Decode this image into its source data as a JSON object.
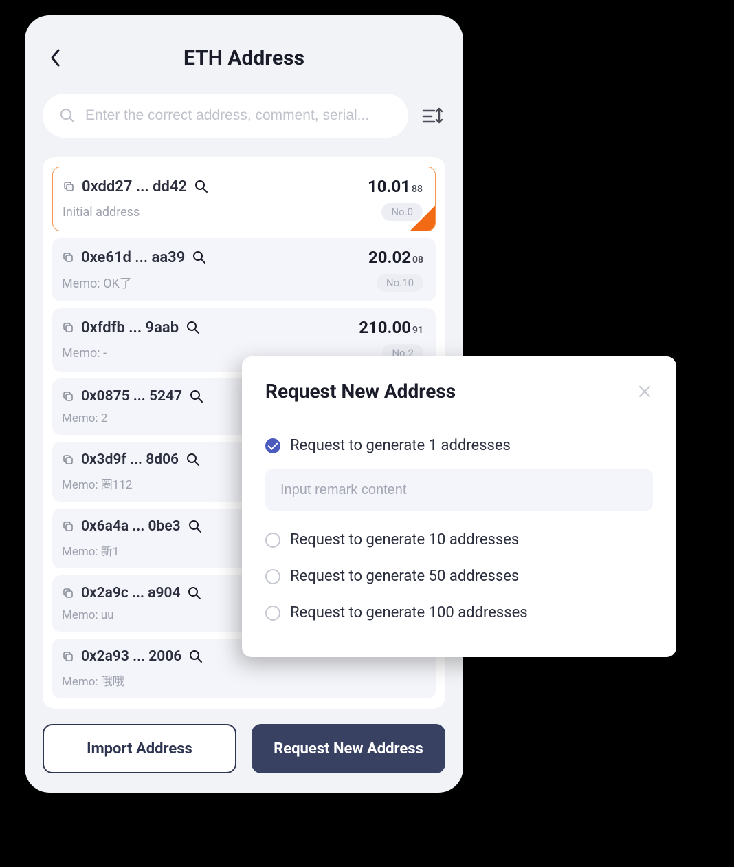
{
  "header": {
    "title": "ETH Address"
  },
  "search": {
    "placeholder": "Enter the correct address, comment, serial..."
  },
  "addresses": [
    {
      "addr": "0xdd27 ... dd42",
      "balance": "10.01",
      "balance_sub": "88",
      "memo": "Initial address",
      "no": "No.0",
      "selected": true
    },
    {
      "addr": "0xe61d ... aa39",
      "balance": "20.02",
      "balance_sub": "08",
      "memo": "Memo: OK了",
      "no": "No.10",
      "selected": false
    },
    {
      "addr": "0xfdfb ... 9aab",
      "balance": "210.00",
      "balance_sub": "91",
      "memo": "Memo: -",
      "no": "No.2",
      "selected": false
    },
    {
      "addr": "0x0875 ... 5247",
      "balance": "",
      "balance_sub": "",
      "memo": "Memo: 2",
      "no": "",
      "selected": false
    },
    {
      "addr": "0x3d9f ... 8d06",
      "balance": "",
      "balance_sub": "",
      "memo": "Memo: 圈112",
      "no": "",
      "selected": false
    },
    {
      "addr": "0x6a4a ... 0be3",
      "balance": "",
      "balance_sub": "",
      "memo": "Memo: 新1",
      "no": "",
      "selected": false
    },
    {
      "addr": "0x2a9c ... a904",
      "balance": "",
      "balance_sub": "",
      "memo": "Memo: uu",
      "no": "",
      "selected": false
    },
    {
      "addr": "0x2a93 ... 2006",
      "balance": "",
      "balance_sub": "",
      "memo": "Memo: 哦哦",
      "no": "",
      "selected": false
    }
  ],
  "footer": {
    "import_label": "Import Address",
    "request_label": "Request New Address"
  },
  "modal": {
    "title": "Request New Address",
    "remark_placeholder": "Input remark content",
    "options": [
      {
        "label": "Request to generate 1 addresses",
        "checked": true
      },
      {
        "label": "Request to generate 10 addresses",
        "checked": false
      },
      {
        "label": "Request to generate 50 addresses",
        "checked": false
      },
      {
        "label": "Request to generate 100 addresses",
        "checked": false
      }
    ]
  }
}
